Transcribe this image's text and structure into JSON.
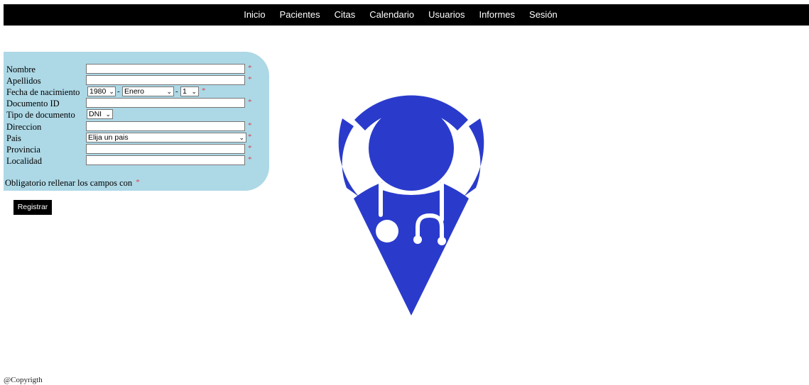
{
  "nav": {
    "items": [
      "Inicio",
      "Pacientes",
      "Citas",
      "Calendario",
      "Usuarios",
      "Informes",
      "Sesión"
    ]
  },
  "form": {
    "fields": {
      "nombre": {
        "label": "Nombre",
        "value": ""
      },
      "apellidos": {
        "label": "Apellidos",
        "value": ""
      },
      "fecha": {
        "label": "Fecha de nacimiento",
        "year": "1980",
        "month": "Enero",
        "day": "1",
        "separator": "-"
      },
      "documento_id": {
        "label": "Documento ID",
        "value": ""
      },
      "tipo_documento": {
        "label": "Tipo de documento",
        "selected": "DNI"
      },
      "direccion": {
        "label": "Direccion",
        "value": ""
      },
      "pais": {
        "label": "Pais",
        "selected": "Elija un pais"
      },
      "provincia": {
        "label": "Provincia",
        "value": ""
      },
      "localidad": {
        "label": "Localidad",
        "value": ""
      }
    },
    "required_mark": "*",
    "note": "Obligatorio rellenar los campos con",
    "submit_label": "Registrar"
  },
  "logo": {
    "icon": "doctor-location-pin-icon",
    "color": "#2a3bcc"
  },
  "footer": {
    "text": "@Copyrigth"
  },
  "colors": {
    "nav_bg": "#000000",
    "panel_bg": "#add8e6",
    "required": "#e0424b",
    "button_bg": "#000000"
  }
}
